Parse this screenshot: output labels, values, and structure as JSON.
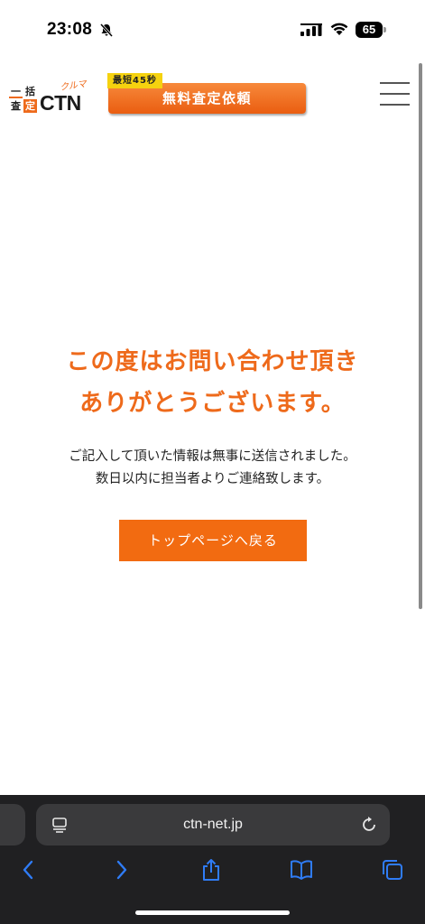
{
  "status_bar": {
    "time": "23:08",
    "battery_level": "65",
    "icons": [
      "bell-muted-icon",
      "signal-icon",
      "wifi-icon",
      "battery-icon"
    ]
  },
  "header": {
    "logo": {
      "chars": [
        "一",
        "括",
        "査",
        "定"
      ],
      "brand": "CTN",
      "sub": "クルマ"
    },
    "cta_badge": "最短45秒",
    "cta_label": "無料査定依頼",
    "menu_icon": "hamburger-menu-icon"
  },
  "main": {
    "title_line1": "この度はお問い合わせ頂き",
    "title_line2": "ありがとうございます。",
    "body_line1": "ご記入して頂いた情報は無事に送信されました。",
    "body_line2": "数日以内に担当者よりご連絡致します。",
    "back_button": "トップページへ戻る"
  },
  "browser": {
    "url": "ctn-net.jp",
    "icons": [
      "reader-icon",
      "reload-icon",
      "back-chevron-icon",
      "forward-chevron-icon",
      "share-icon",
      "bookmarks-icon",
      "tabs-icon"
    ]
  },
  "colors": {
    "accent": "#ee6a1b",
    "button": "#f26b11",
    "badge": "#f5d20f",
    "toolbar_bg": "#202022",
    "toolbar_icon": "#2f7cf6"
  }
}
